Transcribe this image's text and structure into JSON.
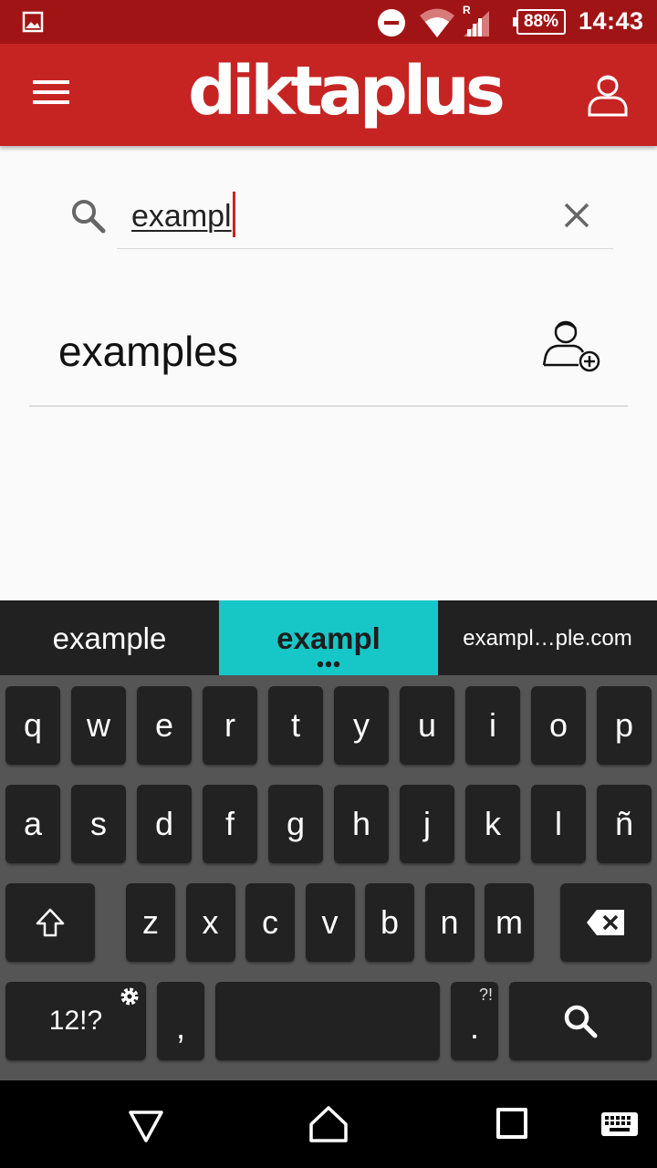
{
  "status_bar": {
    "time": "14:43",
    "battery": "88%",
    "roaming": "R"
  },
  "app_bar": {
    "brand": "diktaplus"
  },
  "search": {
    "value": "exampl"
  },
  "results": [
    {
      "word": "examples"
    }
  ],
  "keyboard": {
    "suggestions": [
      "example",
      "exampl",
      "exampl…ple.com"
    ],
    "rows": [
      [
        "q",
        "w",
        "e",
        "r",
        "t",
        "y",
        "u",
        "i",
        "o",
        "p"
      ],
      [
        "a",
        "s",
        "d",
        "f",
        "g",
        "h",
        "j",
        "k",
        "l",
        "ñ"
      ],
      [
        "z",
        "x",
        "c",
        "v",
        "b",
        "n",
        "m"
      ]
    ],
    "symbols_key": "12!?",
    "comma_key": ",",
    "period_key": ".",
    "period_alt": "?!"
  },
  "colors": {
    "status_bar": "#a01416",
    "app_bar": "#c62423",
    "suggestion_highlight": "#17c7c7",
    "key": "#222222",
    "keyboard_bg": "#555555"
  },
  "icons": [
    "gallery-icon",
    "dnd-icon",
    "wifi-icon",
    "signal-icon",
    "menu-icon",
    "account-icon",
    "search-icon",
    "clear-icon",
    "add-user-icon",
    "shift-icon",
    "backspace-icon",
    "settings-icon",
    "search-key-icon",
    "back-icon",
    "home-icon",
    "recents-icon",
    "keyboard-icon"
  ]
}
